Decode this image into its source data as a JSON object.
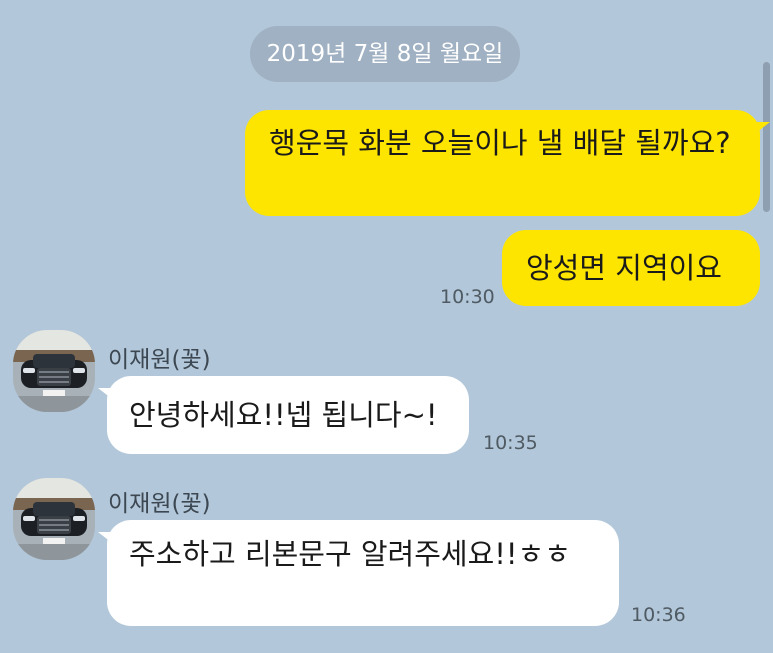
{
  "date_separator": "2019년 7월 8일 월요일",
  "messages": [
    {
      "sender": "me",
      "text": "행운목 화분 오늘이나 낼 배달 될까요?"
    },
    {
      "sender": "me",
      "text": "앙성면 지역이요",
      "time": "10:30"
    },
    {
      "sender": "이재원(꽃)",
      "text": "안녕하세요!!넵 됩니다~!",
      "time": "10:35"
    },
    {
      "sender": "이재원(꽃)",
      "text": "주소하고 리본문구 알려주세요!!ㅎㅎ",
      "time": "10:36"
    }
  ],
  "colors": {
    "background": "#b2c7d9",
    "my_bubble": "#fee500",
    "their_bubble": "#ffffff",
    "date_pill": "#9fb1c2"
  },
  "icons": {
    "avatar": "car-avatar-icon"
  }
}
